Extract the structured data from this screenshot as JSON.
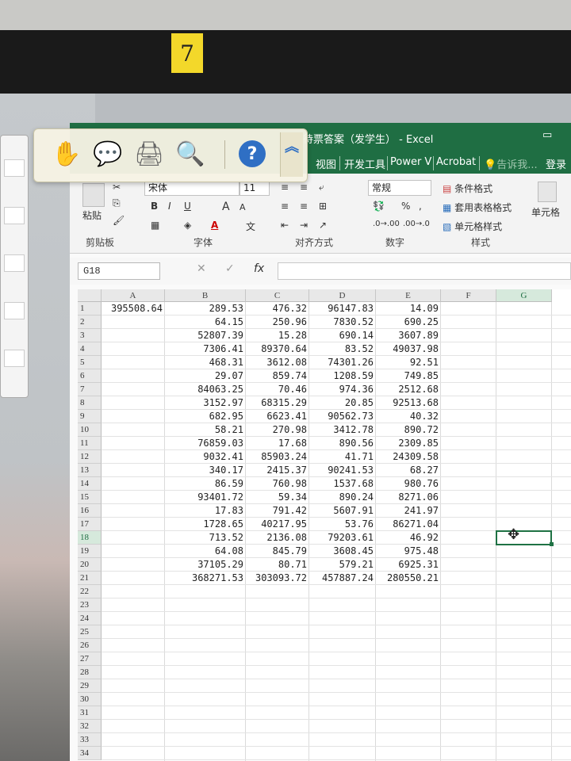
{
  "sticky_label": "7",
  "window": {
    "title": "待票答案（发学生） - Excel",
    "restore_icon": "restore-icon",
    "close_glyph": "✕"
  },
  "tabs": [
    "视图",
    "开发工具",
    "Power V",
    "Acrobat",
    "告诉我...",
    "登录"
  ],
  "ribbon": {
    "paste_label": "粘贴",
    "font_name": "宋体",
    "font_size": "11",
    "bold": "B",
    "italic": "I",
    "underline": "U",
    "grow_font": "A",
    "shrink_font": "A",
    "number_format": "常规",
    "percent": "%",
    "comma": ",",
    "conditional_format": "条件格式",
    "table_format": "套用表格格式",
    "cell_style": "单元格样式",
    "cells_label": "单元格",
    "groups": {
      "clipboard": "剪贴板",
      "font": "字体",
      "alignment": "对齐方式",
      "number": "数字",
      "styles": "样式"
    }
  },
  "formula_bar": {
    "name_box": "G18",
    "cancel": "✕",
    "enter": "✓",
    "fx": "fx",
    "value": ""
  },
  "grid": {
    "columns": [
      "A",
      "B",
      "C",
      "D",
      "E",
      "F",
      "G"
    ],
    "rows": [
      "1",
      "2",
      "3",
      "4",
      "5",
      "6",
      "7",
      "8",
      "9",
      "10",
      "11",
      "12",
      "13",
      "14",
      "15",
      "16",
      "17",
      "18",
      "19",
      "20",
      "21",
      "22",
      "23",
      "24",
      "25",
      "26",
      "27",
      "28",
      "29",
      "30",
      "31",
      "32",
      "33",
      "34"
    ],
    "active_row": "18",
    "selected_cell": "G18",
    "cells": [
      [
        "395508.64",
        "289.53",
        "476.32",
        "96147.83",
        "14.09"
      ],
      [
        "",
        "64.15",
        "250.96",
        "7830.52",
        "690.25"
      ],
      [
        "",
        "52807.39",
        "15.28",
        "690.14",
        "3607.89"
      ],
      [
        "",
        "7306.41",
        "89370.64",
        "83.52",
        "49037.98"
      ],
      [
        "",
        "468.31",
        "3612.08",
        "74301.26",
        "92.51"
      ],
      [
        "",
        "29.07",
        "859.74",
        "1208.59",
        "749.85"
      ],
      [
        "",
        "84063.25",
        "70.46",
        "974.36",
        "2512.68"
      ],
      [
        "",
        "3152.97",
        "68315.29",
        "20.85",
        "92513.68"
      ],
      [
        "",
        "682.95",
        "6623.41",
        "90562.73",
        "40.32"
      ],
      [
        "",
        "58.21",
        "270.98",
        "3412.78",
        "890.72"
      ],
      [
        "",
        "76859.03",
        "17.68",
        "890.56",
        "2309.85"
      ],
      [
        "",
        "9032.41",
        "85903.24",
        "41.71",
        "24309.58"
      ],
      [
        "",
        "340.17",
        "2415.37",
        "90241.53",
        "68.27"
      ],
      [
        "",
        "86.59",
        "760.98",
        "1537.68",
        "980.76"
      ],
      [
        "",
        "93401.72",
        "59.34",
        "890.24",
        "8271.06"
      ],
      [
        "",
        "17.83",
        "791.42",
        "5607.91",
        "241.97"
      ],
      [
        "",
        "1728.65",
        "40217.95",
        "53.76",
        "86271.04"
      ],
      [
        "",
        "713.52",
        "2136.08",
        "79203.61",
        "46.92"
      ],
      [
        "",
        "64.08",
        "845.79",
        "3608.45",
        "975.48"
      ],
      [
        "",
        "37105.29",
        "80.71",
        "579.21",
        "6925.31"
      ],
      [
        "",
        "368271.53",
        "303093.72",
        "457887.24",
        "280550.21"
      ]
    ]
  },
  "floating_toolbar": {
    "icons": [
      "hand-icon",
      "comment-icon",
      "print-icon",
      "magnifier-icon",
      "help-icon"
    ],
    "help_glyph": "?"
  },
  "colors": {
    "excel_green": "#1f6e43",
    "sticky_yellow": "#f3d82a"
  }
}
